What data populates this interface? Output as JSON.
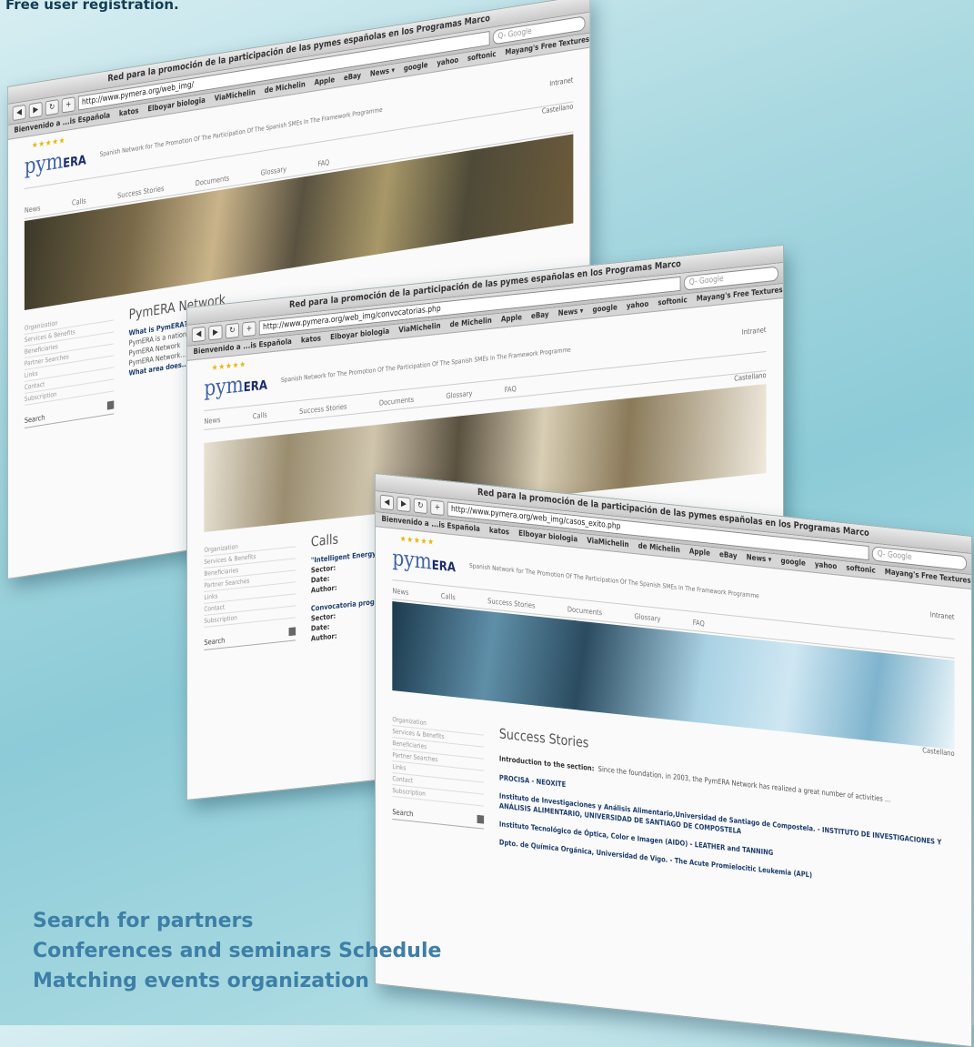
{
  "caption": "Free user registration.",
  "features": [
    "Search for partners",
    "Conferences and seminars Schedule",
    "Matching events organization"
  ],
  "browser": {
    "title": "Red para la promoción de la participación de las pymes españolas en los Programas Marco",
    "search_placeholder": "Q- Google",
    "bookmarks": [
      "Bienvenido a ...is Española",
      "katos",
      "Elboyar biologia",
      "ViaMichelin",
      "de Michelin",
      "Apple",
      "eBay",
      "News ▾",
      "google",
      "yahoo",
      "softonic",
      "Mayang's Free Textures"
    ]
  },
  "windows": [
    {
      "url": "http://www.pymera.org/web_img/",
      "heading": "PymERA Network",
      "subheading": "What is PymERA?",
      "paragraphs": [
        "PymERA is a national...",
        "PymERA Network",
        "PymERA Network..."
      ],
      "subheading2": "What area does..."
    },
    {
      "url": "http://www.pymera.org/web_img/convocatorias.php",
      "heading": "Calls",
      "items": [
        {
          "title": "\"Intelligent Energy",
          "sector": "Sector:",
          "date": "Date:",
          "author": "Author:"
        },
        {
          "title": "Convocatoria progr",
          "sector": "Sector:",
          "date": "Date:",
          "author": "Author:"
        }
      ]
    },
    {
      "url": "http://www.pymera.org/web_img/casos_exito.php",
      "heading": "Success Stories",
      "intro_label": "Introduction to the section:",
      "intro_text": "Since the foundation, in 2003, the PymERA Network has realized a great number of activities ...",
      "stories": [
        {
          "title": "PROCISA - NEOXITE"
        },
        {
          "title": "Instituto de Investigaciones y Análisis Alimentario,Universidad de Santiago de Compostela. - INSTITUTO DE INVESTIGACIONES Y ANÁLISIS ALIMENTARIO, UNIVERSIDAD DE SANTIAGO DE COMPOSTELA"
        },
        {
          "title": "Instituto Tecnológico de Óptica, Color e Imagen (AIDO) - LEATHER and TANNING"
        },
        {
          "title": "Dpto. de Química Orgánica, Universidad de Vigo. - The Acute Promielocitic Leukemia (APL)"
        }
      ]
    }
  ],
  "site": {
    "logo_text": "pym",
    "logo_bold": "ERA",
    "tagline": "Spanish Network for The Promotion Of The Participation Of The Spanish SMEs In The Framework Programme",
    "intranet": "Intranet",
    "menu": [
      "News",
      "Calls",
      "Success Stories",
      "Documents",
      "Glossary",
      "FAQ"
    ],
    "lang": "Castellano",
    "sidebar": [
      "Organization",
      "Services & Benefits",
      "Beneficiaries",
      "Partner Searches",
      "Links",
      "Contact",
      "Subscription"
    ],
    "search_label": "Search"
  }
}
